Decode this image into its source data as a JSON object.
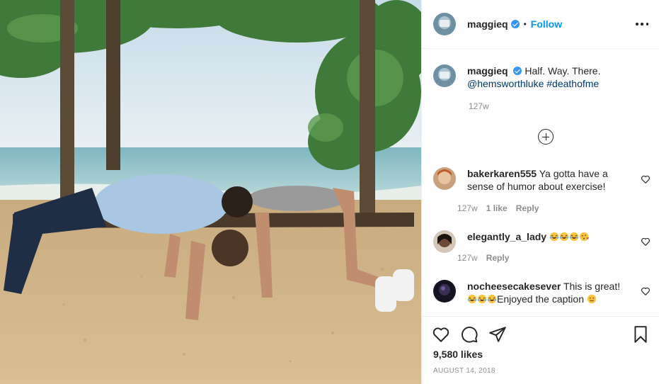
{
  "post": {
    "author": "maggieq",
    "follow_label": "Follow",
    "separator": "•",
    "caption_text": "Half. Way. There.",
    "caption_mention": "@hemsworthluke",
    "caption_hashtag": "#deathofme",
    "caption_time": "127w",
    "likes": "9,580 likes",
    "date": "August 14, 2018"
  },
  "comments": [
    {
      "user": "bakerkaren555",
      "text": "Ya gotta have a sense of humor about exercise!",
      "time": "127w",
      "likes": "1 like",
      "reply": "Reply"
    },
    {
      "user": "elegantly_a_lady",
      "text": "",
      "emoji": [
        "laughing-crying",
        "laughing-crying",
        "laughing-crying",
        "kissing-heart"
      ],
      "time": "127w",
      "reply": "Reply"
    },
    {
      "user": "nocheesecakesever",
      "text": "This is great!",
      "text2": "Enjoyed the caption",
      "emoji": [
        "laughing-crying",
        "laughing-crying",
        "laughing-crying",
        "smile"
      ]
    }
  ],
  "icons": [
    "verified-badge",
    "more-icon",
    "load-more-icon",
    "heart-icon",
    "comment-icon",
    "share-icon",
    "bookmark-icon"
  ],
  "colors": {
    "accent": "#0095f6",
    "verified": "#3897f0",
    "link": "#00376b",
    "muted": "#8e8e8e",
    "text": "#262626"
  }
}
